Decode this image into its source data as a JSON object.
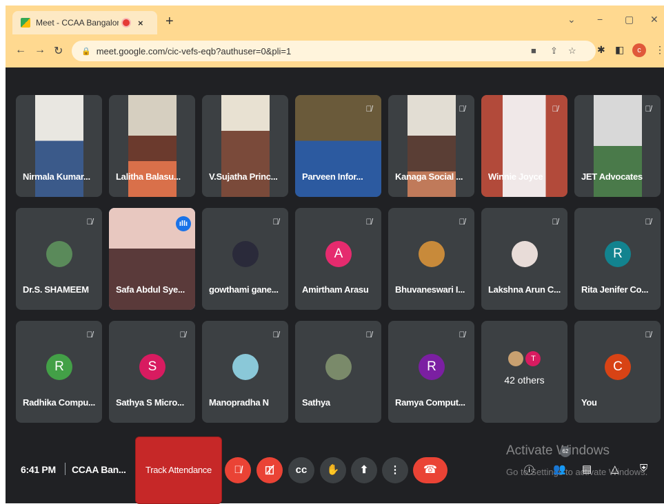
{
  "browser": {
    "tab_title": "Meet - CCAA Bangalore Chap",
    "tab_close": "×",
    "new_tab": "+",
    "window_controls": [
      "⌄",
      "−",
      "▢",
      "✕"
    ],
    "url": "meet.google.com/cic-vefs-eqb?authuser=0&pli=1",
    "back": "←",
    "forward": "→",
    "reload": "↻",
    "profile_initial": "c"
  },
  "participants": [
    {
      "name": "Nirmala Kumar...",
      "type": "video"
    },
    {
      "name": "Lalitha Balasu...",
      "type": "video"
    },
    {
      "name": "V.Sujatha Princ...",
      "type": "video"
    },
    {
      "name": "Parveen Infor...",
      "type": "video",
      "muted": true
    },
    {
      "name": "Kanaga Social ...",
      "type": "video",
      "muted": true
    },
    {
      "name": "Winnie Joyce",
      "type": "video",
      "muted": true
    },
    {
      "name": "JET Advocates",
      "type": "video",
      "muted": true
    },
    {
      "name": "Dr.S. SHAMEEM",
      "type": "avatar-photo",
      "muted": true
    },
    {
      "name": "Safa Abdul Sye...",
      "type": "video",
      "speaking": true
    },
    {
      "name": "gowthami gane...",
      "type": "avatar-photo",
      "muted": true
    },
    {
      "name": "Amirtham Arasu",
      "type": "avatar",
      "initial": "A",
      "color": "#e52b6e",
      "muted": true
    },
    {
      "name": "Bhuvaneswari I...",
      "type": "avatar-photo",
      "muted": true
    },
    {
      "name": "Lakshna Arun C...",
      "type": "avatar-photo",
      "muted": true
    },
    {
      "name": "Rita Jenifer Co...",
      "type": "avatar",
      "initial": "R",
      "color": "#12838f",
      "muted": true
    },
    {
      "name": "Radhika Compu...",
      "type": "avatar",
      "initial": "R",
      "color": "#43a047",
      "muted": true
    },
    {
      "name": "Sathya S Micro...",
      "type": "avatar",
      "initial": "S",
      "color": "#d81b60",
      "muted": true
    },
    {
      "name": "Manopradha N",
      "type": "avatar-photo",
      "muted": true
    },
    {
      "name": "Sathya",
      "type": "avatar-photo",
      "muted": true
    },
    {
      "name": "Ramya Comput...",
      "type": "avatar",
      "initial": "R",
      "color": "#7b1fa2",
      "muted": true
    },
    {
      "name": "42 others",
      "type": "others",
      "mini_initial": "T"
    },
    {
      "name": "You",
      "type": "avatar",
      "initial": "C",
      "color": "#d84315",
      "muted": true
    }
  ],
  "bottom": {
    "time": "6:41 PM",
    "meeting_name": "CCAA Ban...",
    "track_attendance": "Track Attendance",
    "people_count": "62",
    "watermark_line1": "Activate Windows",
    "watermark_line2": "Go to Settings to activate Windows."
  }
}
